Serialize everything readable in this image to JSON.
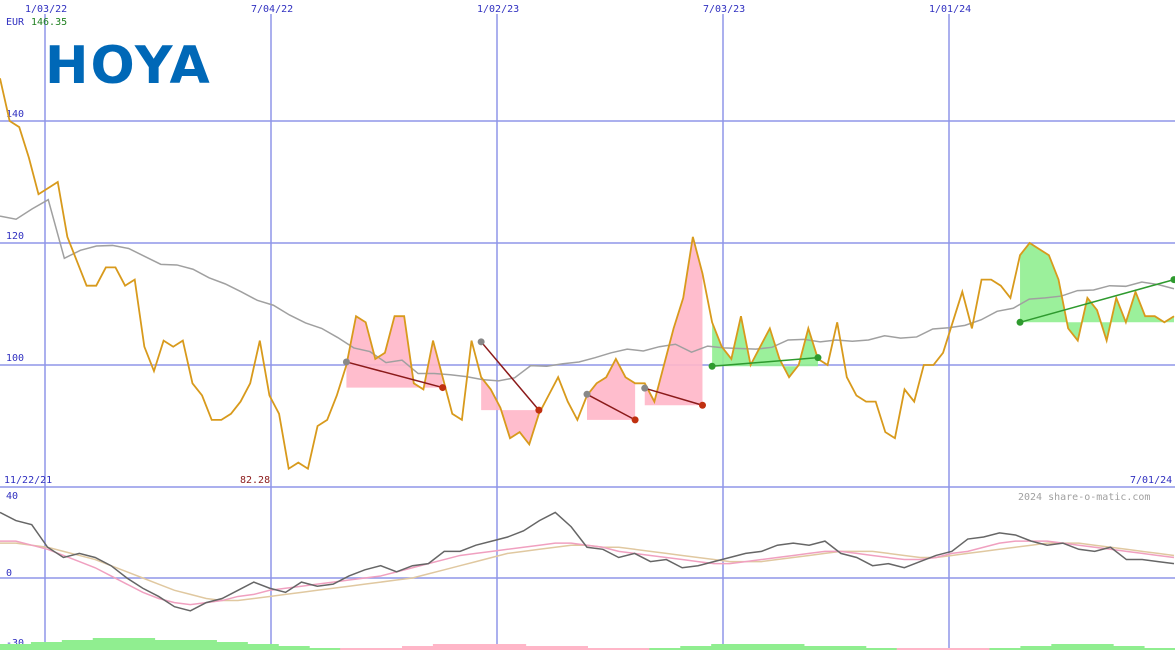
{
  "logo": {
    "text": "HOYA",
    "color": "#0068b7"
  },
  "header": {
    "currency": "EUR",
    "last_price": "146.35"
  },
  "top_dates": [
    "1/03/22",
    "7/04/22",
    "1/02/23",
    "7/03/23",
    "1/01/24"
  ],
  "range_labels": {
    "start": "11/22/21",
    "end": "7/01/24"
  },
  "low_label": "82.28",
  "copyright": "2024 share-o-matic.com",
  "colors": {
    "price": "#d89a1c",
    "moving_average": "#a0a0a0",
    "grid": "#8f95e8",
    "up_fill": "#90ee90",
    "down_fill": "#ffb6c8",
    "up_line": "#2e9a2e",
    "down_line": "#8b1a1a",
    "osc_main": "#666666",
    "osc_pink": "#f0a0c0",
    "osc_tan": "#e0c8a0"
  },
  "chart_data": [
    {
      "type": "line",
      "title": "",
      "y_ticks": [
        100,
        120,
        140
      ],
      "ylim": [
        80,
        147
      ],
      "x_range": [
        "2021-11-22",
        "2024-07-01"
      ],
      "series": [
        {
          "values": [
            147,
            140,
            139,
            134,
            128,
            129,
            130,
            121,
            117,
            113,
            113,
            116,
            116,
            113,
            114,
            103,
            99,
            104,
            103,
            104,
            97,
            95,
            91,
            91,
            92,
            94,
            97,
            104,
            95,
            92,
            83,
            84,
            83,
            90,
            91,
            95,
            100,
            108,
            107,
            101,
            102,
            108,
            108,
            97,
            96,
            104,
            98,
            92,
            91,
            104,
            98,
            96,
            93,
            88,
            89,
            87,
            92,
            95,
            98,
            94,
            91,
            95,
            97,
            98,
            101,
            98,
            97,
            97,
            94,
            100,
            106,
            111,
            121,
            115,
            107,
            103,
            101,
            108,
            100,
            103,
            106,
            101,
            98,
            100,
            106,
            101,
            100,
            107,
            98,
            95,
            94,
            94,
            89,
            88,
            96,
            94,
            100,
            100,
            102,
            107,
            112,
            106,
            114,
            114,
            113,
            111,
            118,
            120,
            119,
            118,
            114,
            106,
            104,
            111,
            109,
            104,
            111,
            107,
            112,
            108,
            108,
            107,
            108
          ],
          "color": "#d89a1c"
        },
        {
          "values": [
            124.4,
            123.9,
            125.6,
            127.1,
            117.5,
            118.8,
            119.5,
            119.6,
            119.1,
            117.8,
            116.5,
            116.4,
            115.7,
            114.3,
            113.3,
            112,
            110.6,
            109.8,
            108.2,
            106.9,
            106,
            104.5,
            102.8,
            102.2,
            100.4,
            100.8,
            98.6,
            98.6,
            98.4,
            98.1,
            97.6,
            97.4,
            97.9,
            99.9,
            99.8,
            100.2,
            100.5,
            101.2,
            102,
            102.6,
            102.3,
            103,
            103.4,
            102.1,
            103.1,
            102.8,
            102.7,
            102.6,
            102.9,
            104.1,
            104.2,
            103.8,
            104.1,
            103.9,
            104.1,
            104.8,
            104.4,
            104.6,
            105.9,
            106.1,
            106.5,
            107.4,
            108.8,
            109.3,
            110.8,
            111,
            111.3,
            112.2,
            112.3,
            113,
            112.9,
            113.6,
            113.2,
            112.5
          ],
          "color": "#a0a0a0"
        }
      ],
      "trend_segments": [
        {
          "direction": "down",
          "from": 100.5,
          "to": 96.3
        },
        {
          "direction": "down",
          "from": 103.8,
          "to": 92.6
        },
        {
          "direction": "down",
          "from": 95.2,
          "to": 91.0
        },
        {
          "direction": "down",
          "from": 96.2,
          "to": 93.4
        },
        {
          "direction": "up",
          "from": 99.8,
          "to": 101.2
        },
        {
          "direction": "up",
          "from": 107.0,
          "to": 114.0
        }
      ]
    },
    {
      "type": "line",
      "title": "",
      "y_ticks": [
        40,
        0,
        -30
      ],
      "ylim": [
        -30,
        40
      ],
      "series": [
        {
          "name": "",
          "values": [
            32,
            28,
            26,
            15,
            10,
            12,
            10,
            6,
            0,
            -5,
            -9,
            -14,
            -16,
            -12,
            -10,
            -6,
            -2,
            -5,
            -7,
            -2,
            -4,
            -3,
            1,
            4,
            6,
            3,
            6,
            7,
            13,
            13,
            16,
            18,
            20,
            23,
            28,
            32,
            25,
            15,
            14,
            10,
            12,
            8,
            9,
            5,
            6,
            8,
            10,
            12,
            13,
            16,
            17,
            16,
            18,
            12,
            10,
            6,
            7,
            5,
            8,
            11,
            13,
            19,
            20,
            22,
            21,
            18,
            16,
            17,
            14,
            13,
            15,
            9,
            9,
            8,
            7
          ]
        },
        {
          "name": "",
          "values": [
            18,
            18,
            16,
            14,
            11,
            8,
            5,
            1,
            -3,
            -7,
            -10,
            -12,
            -13,
            -12,
            -11,
            -9,
            -8,
            -6,
            -5,
            -4,
            -3,
            -2,
            -1,
            0,
            1,
            3,
            5,
            7,
            9,
            11,
            12,
            13,
            14,
            15,
            16,
            17,
            17,
            16,
            15,
            13,
            12,
            11,
            10,
            9,
            8,
            7,
            7,
            8,
            9,
            10,
            11,
            12,
            13,
            13,
            12,
            11,
            10,
            9,
            9,
            10,
            12,
            13,
            15,
            17,
            18,
            18,
            18,
            17,
            16,
            15,
            14,
            13,
            12,
            11,
            10
          ]
        },
        {
          "name": "",
          "values": [
            17,
            17,
            16,
            15,
            13,
            11,
            9,
            6,
            3,
            0,
            -3,
            -6,
            -8,
            -10,
            -11,
            -11,
            -10,
            -9,
            -8,
            -7,
            -6,
            -5,
            -4,
            -3,
            -2,
            -1,
            0,
            2,
            4,
            6,
            8,
            10,
            12,
            13,
            14,
            15,
            16,
            16,
            15,
            15,
            14,
            13,
            12,
            11,
            10,
            9,
            8,
            8,
            8,
            9,
            10,
            11,
            12,
            13,
            13,
            13,
            12,
            11,
            10,
            10,
            11,
            12,
            13,
            14,
            15,
            16,
            17,
            17,
            17,
            16,
            15,
            14,
            13,
            12,
            11
          ]
        }
      ],
      "bars": [
        3,
        4,
        5,
        6,
        6,
        5,
        5,
        4,
        3,
        2,
        1,
        -1,
        -1,
        -2,
        -3,
        -3,
        -3,
        -2,
        -2,
        -1,
        -1,
        1,
        2,
        3,
        3,
        3,
        2,
        2,
        1,
        -1,
        -1,
        -1,
        1,
        2,
        3,
        3,
        2,
        1
      ]
    }
  ]
}
